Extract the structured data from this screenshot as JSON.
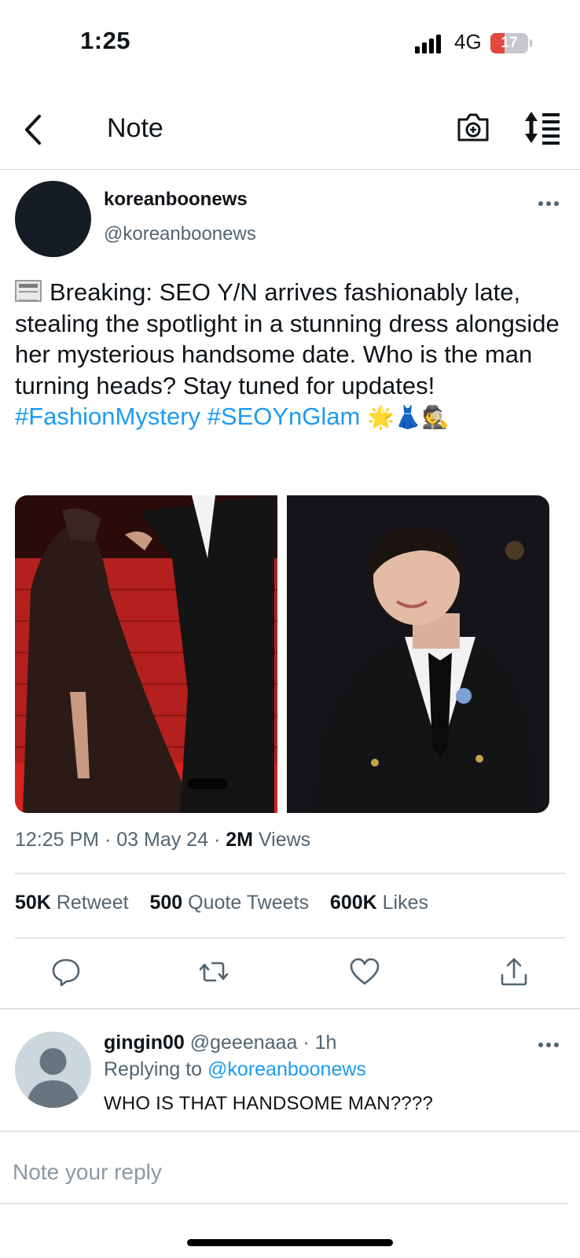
{
  "status_bar": {
    "time": "1:25",
    "network": "4G",
    "battery_level": "17",
    "battery_fraction": 0.17,
    "signal_icon": "cellular-signal-icon"
  },
  "header": {
    "title": "Note",
    "back_icon": "chevron-left-icon",
    "camera_icon": "camera-icon",
    "sort_icon": "sort-list-icon"
  },
  "tweet": {
    "author_name": "koreanboonews",
    "author_handle": "@koreanboonews",
    "text": "Breaking: SEO Y/N arrives fashionably late, stealing the spotlight in a stunning dress alongside her mysterious handsome date. Who is the man turning heads? Stay tuned for updates!",
    "hashtag_1": "#FashionMystery",
    "hashtag_2": "#SEOYnGlam",
    "emojis": "🌟👗🕵",
    "lead_emoji_icon": "newspaper-icon",
    "media": [
      {
        "description_icon": "red-carpet-couple-photo"
      },
      {
        "description_icon": "man-in-black-suit-photo"
      }
    ],
    "time": "12:25 PM",
    "date": "03 May 24",
    "sep": "·",
    "views_count": "2M",
    "views_label": "Views",
    "stats": [
      {
        "count": "50K",
        "label": "Retweet"
      },
      {
        "count": "500",
        "label": "Quote Tweets"
      },
      {
        "count": "600K",
        "label": "Likes"
      }
    ],
    "actions": [
      "reply-icon",
      "retweet-icon",
      "like-icon",
      "share-icon"
    ]
  },
  "reply": {
    "name": "gingin00",
    "handle": "@geeenaaa",
    "sep": "·",
    "time": "1h",
    "replying_prefix": "Replying to",
    "replying_to": "@koreanboonews",
    "text": "WHO IS THAT HANDSOME MAN????"
  },
  "composer": {
    "placeholder": "Note your reply"
  },
  "colors": {
    "link": "#1d9bf0",
    "secondary_text": "#536471",
    "battery_low": "#e5483e"
  }
}
